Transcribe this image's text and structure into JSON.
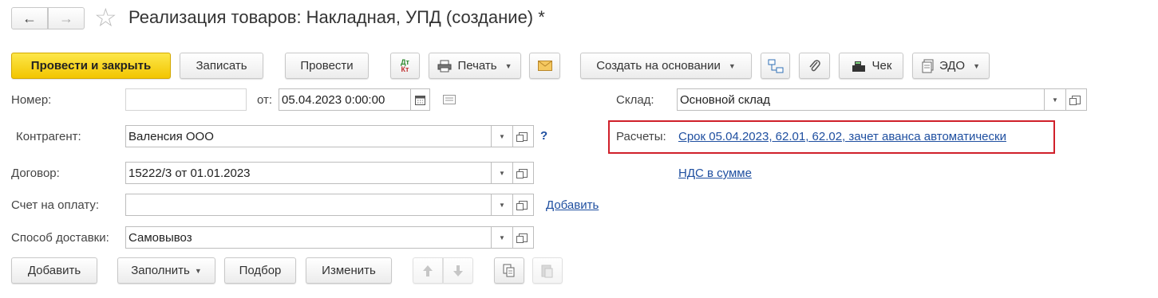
{
  "title": "Реализация товаров: Накладная, УПД (создание) *",
  "nav": {
    "back_icon": "←",
    "forward_icon": "→",
    "star_icon": "☆"
  },
  "toolbar": {
    "post_close": "Провести и закрыть",
    "save": "Записать",
    "post": "Провести",
    "dtkt_top": "Дт",
    "dtkt_bottom": "Кт",
    "print": "Печать",
    "create_based": "Создать на основании",
    "receipt": "Чек",
    "edo": "ЭДО"
  },
  "form": {
    "number_label": "Номер:",
    "number_value": "",
    "date_prefix": "от:",
    "date_value": "05.04.2023  0:00:00",
    "warehouse_label": "Склад:",
    "warehouse_value": "Основной склад",
    "counterparty_label": "Контрагент:",
    "counterparty_value": "Валенсия ООО",
    "help_mark": "?",
    "settlements_label": "Расчеты:",
    "settlements_link": "Срок 05.04.2023, 62.01, 62.02, зачет аванса автоматически",
    "vat_link": "НДС в сумме",
    "contract_label": "Договор:",
    "contract_value": "15222/3 от 01.01.2023",
    "invoice_label": "Счет на оплату:",
    "invoice_value": "",
    "invoice_add_link": "Добавить",
    "delivery_label": "Способ доставки:",
    "delivery_value": "Самовывоз"
  },
  "table_toolbar": {
    "add": "Добавить",
    "fill": "Заполнить",
    "pick": "Подбор",
    "change": "Изменить"
  },
  "colors": {
    "highlight_border": "#d0202a",
    "link": "#1f4fa0",
    "primary": "#f5cd10"
  }
}
